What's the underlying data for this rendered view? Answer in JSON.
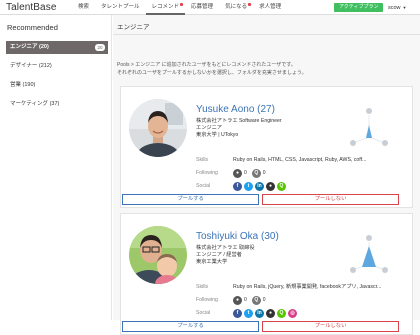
{
  "app": {
    "logo": "TalentBase"
  },
  "nav": {
    "items": [
      {
        "label": "検索"
      },
      {
        "label": "タレントプール"
      },
      {
        "label": "レコメンド"
      },
      {
        "label": "応募管理"
      },
      {
        "label": "気になる"
      },
      {
        "label": "求人管理"
      }
    ],
    "plan": "アクティブプラン",
    "user": "scow"
  },
  "sidebar": {
    "title": "Recommended",
    "items": [
      {
        "label": "エンジニア (20)",
        "badge": "20"
      },
      {
        "label": "デザイナー (212)"
      },
      {
        "label": "営業 (190)"
      },
      {
        "label": "マーケティング (37)"
      }
    ]
  },
  "main": {
    "title": "エンジニア",
    "desc1": "Pools > エンジニア に追加されたユーザをもとにレコメンドされたユーザです。",
    "desc2": "それぞれのユーザをプールするかしないかを選択し、フォルダを充実させましょう。"
  },
  "labels": {
    "skills": "Skills",
    "following": "Following",
    "social": "Social",
    "pool": "プールする",
    "nopool": "プールしない"
  },
  "candidates": [
    {
      "name": "Yusuke Aono (27)",
      "company": "株式会社アトラエ Software Engineer",
      "role": "エンジニア",
      "school": "東京大学 | UTokyo",
      "skills": "Ruby on Rails, HTML, CSS, Javascript, Ruby, AWS, coff...",
      "f1": "0",
      "f2": "0"
    },
    {
      "name": "Toshiyuki Oka (30)",
      "company": "株式会社アトラエ 取締役",
      "role": "エンジニア / 経営者",
      "school": "東京工業大学",
      "skills": "Ruby on Rails, jQuery, 新規事業開発, facebookアプリ, Javascr...",
      "f1": "0",
      "f2": "0"
    }
  ],
  "colors": {
    "accent": "#3b73b6",
    "plan": "#3fbf5f",
    "danger": "#d9444d",
    "sidebar_active": "#6f6869"
  }
}
